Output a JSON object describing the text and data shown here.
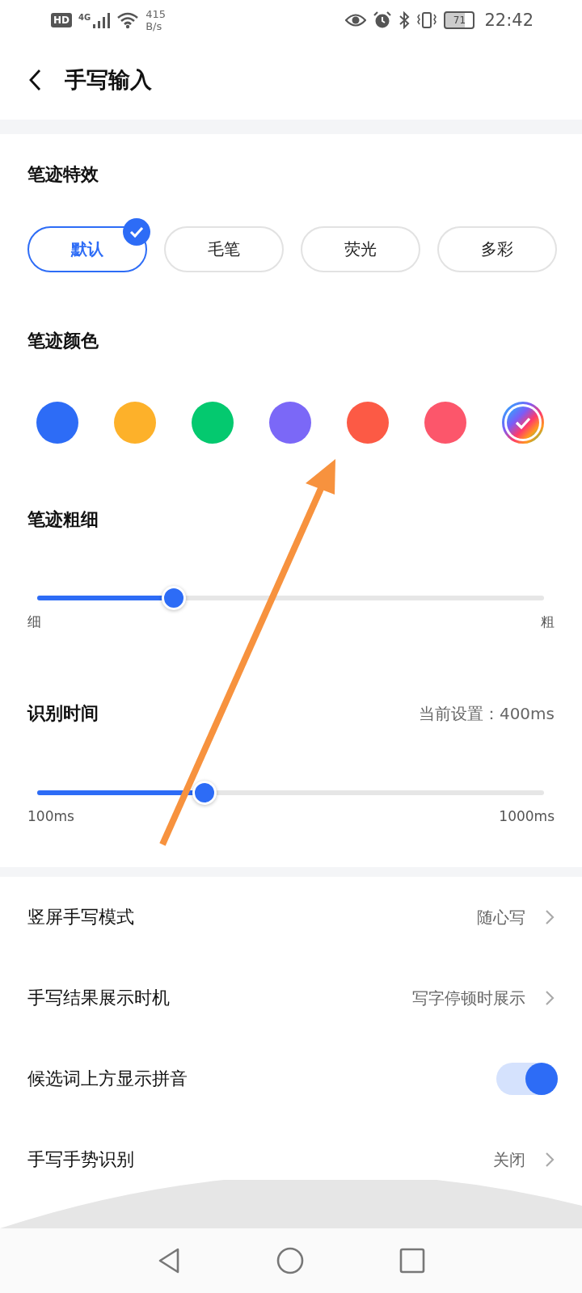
{
  "status_bar": {
    "hd": "HD",
    "network": "4G",
    "speed": "415",
    "speed_unit": "B/s",
    "battery": "71",
    "time": "22:42"
  },
  "header": {
    "title": "手写输入"
  },
  "effects": {
    "title": "笔迹特效",
    "options": [
      {
        "label": "默认",
        "selected": true
      },
      {
        "label": "毛笔",
        "selected": false
      },
      {
        "label": "荧光",
        "selected": false
      },
      {
        "label": "多彩",
        "selected": false
      }
    ]
  },
  "colors": {
    "title": "笔迹颜色",
    "swatches": [
      {
        "kind": "solid",
        "color": "#2d6cf6",
        "selected": false
      },
      {
        "kind": "solid",
        "color": "#fdb12a",
        "selected": false
      },
      {
        "kind": "solid",
        "color": "#04c96f",
        "selected": false
      },
      {
        "kind": "solid",
        "color": "#7b68f7",
        "selected": false
      },
      {
        "kind": "solid",
        "color": "#fc5a45",
        "selected": false
      },
      {
        "kind": "solid",
        "color": "#fc566b",
        "selected": false
      },
      {
        "kind": "rainbow",
        "selected": true
      }
    ]
  },
  "thickness": {
    "title": "笔迹粗细",
    "level": 0.27,
    "min_label": "细",
    "max_label": "粗"
  },
  "recognition_time": {
    "title": "识别时间",
    "current": "当前设置：400ms",
    "level": 0.33,
    "min_label": "100ms",
    "max_label": "1000ms"
  },
  "settings": [
    {
      "kind": "link",
      "label": "竖屏手写模式",
      "value": "随心写"
    },
    {
      "kind": "link",
      "label": "手写结果展示时机",
      "value": "写字停顿时展示"
    },
    {
      "kind": "toggle",
      "label": "候选词上方显示拼音",
      "on": true
    },
    {
      "kind": "link",
      "label": "手写手势识别",
      "value": "关闭"
    }
  ]
}
